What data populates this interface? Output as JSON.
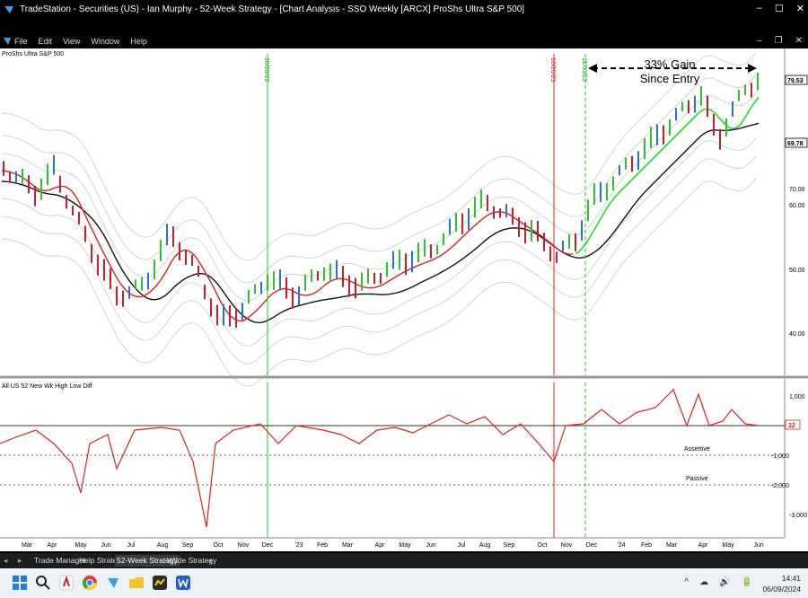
{
  "app": {
    "title": "TradeStation - Securities (US) - Ian Murphy - 52-Week Strategy - [Chart Analysis - SSO Weekly [ARCX] ProShs Ultra S&P 500]",
    "window_controls": [
      "–",
      "☐",
      "✕"
    ]
  },
  "menu": {
    "items": [
      "File",
      "Edit",
      "View",
      "Window",
      "Help"
    ],
    "child_controls": [
      "–",
      "❐",
      "✕"
    ]
  },
  "chart": {
    "symbol_label": "ProShs Ultra S&P 500",
    "annotation_line1": "33% Gain",
    "annotation_line2": "Since Entry",
    "price_axis": [
      "70.00",
      "60.00",
      "50.00",
      "40.00"
    ],
    "last_price": "79.53",
    "ma_value": "69.78",
    "indicator_label": "All US 52 New Wk High Low Diff",
    "indicator_axis": [
      "1,000",
      "-1,000",
      "-2,000",
      "-3,000"
    ],
    "indicator_last": "22",
    "level_labels": [
      "Assertive",
      "Passive"
    ],
    "vline_labels": [
      "10/20/22",
      "10/26/23",
      "11/03/23"
    ],
    "x_labels": [
      "Mar",
      "Apr",
      "May",
      "Jun",
      "Jul",
      "Aug",
      "Sep",
      "Oct",
      "Nov",
      "Dec",
      "'23",
      "Feb",
      "Mar",
      "Apr",
      "May",
      "Jun",
      "Jul",
      "Aug",
      "Sep",
      "Oct",
      "Nov",
      "Dec",
      "'24",
      "Feb",
      "Mar",
      "Apr",
      "May",
      "Jun"
    ]
  },
  "tabs": [
    "Trade Manager",
    "Help Strategy",
    "52-Week Strategy",
    "Wilde Strategy"
  ],
  "tab_add": "+",
  "taskbar": {
    "time": "14:41",
    "date": "06/09/2024",
    "tray_glyphs": [
      "^",
      "☁",
      "🔊",
      "🔋",
      "🔔"
    ]
  }
}
